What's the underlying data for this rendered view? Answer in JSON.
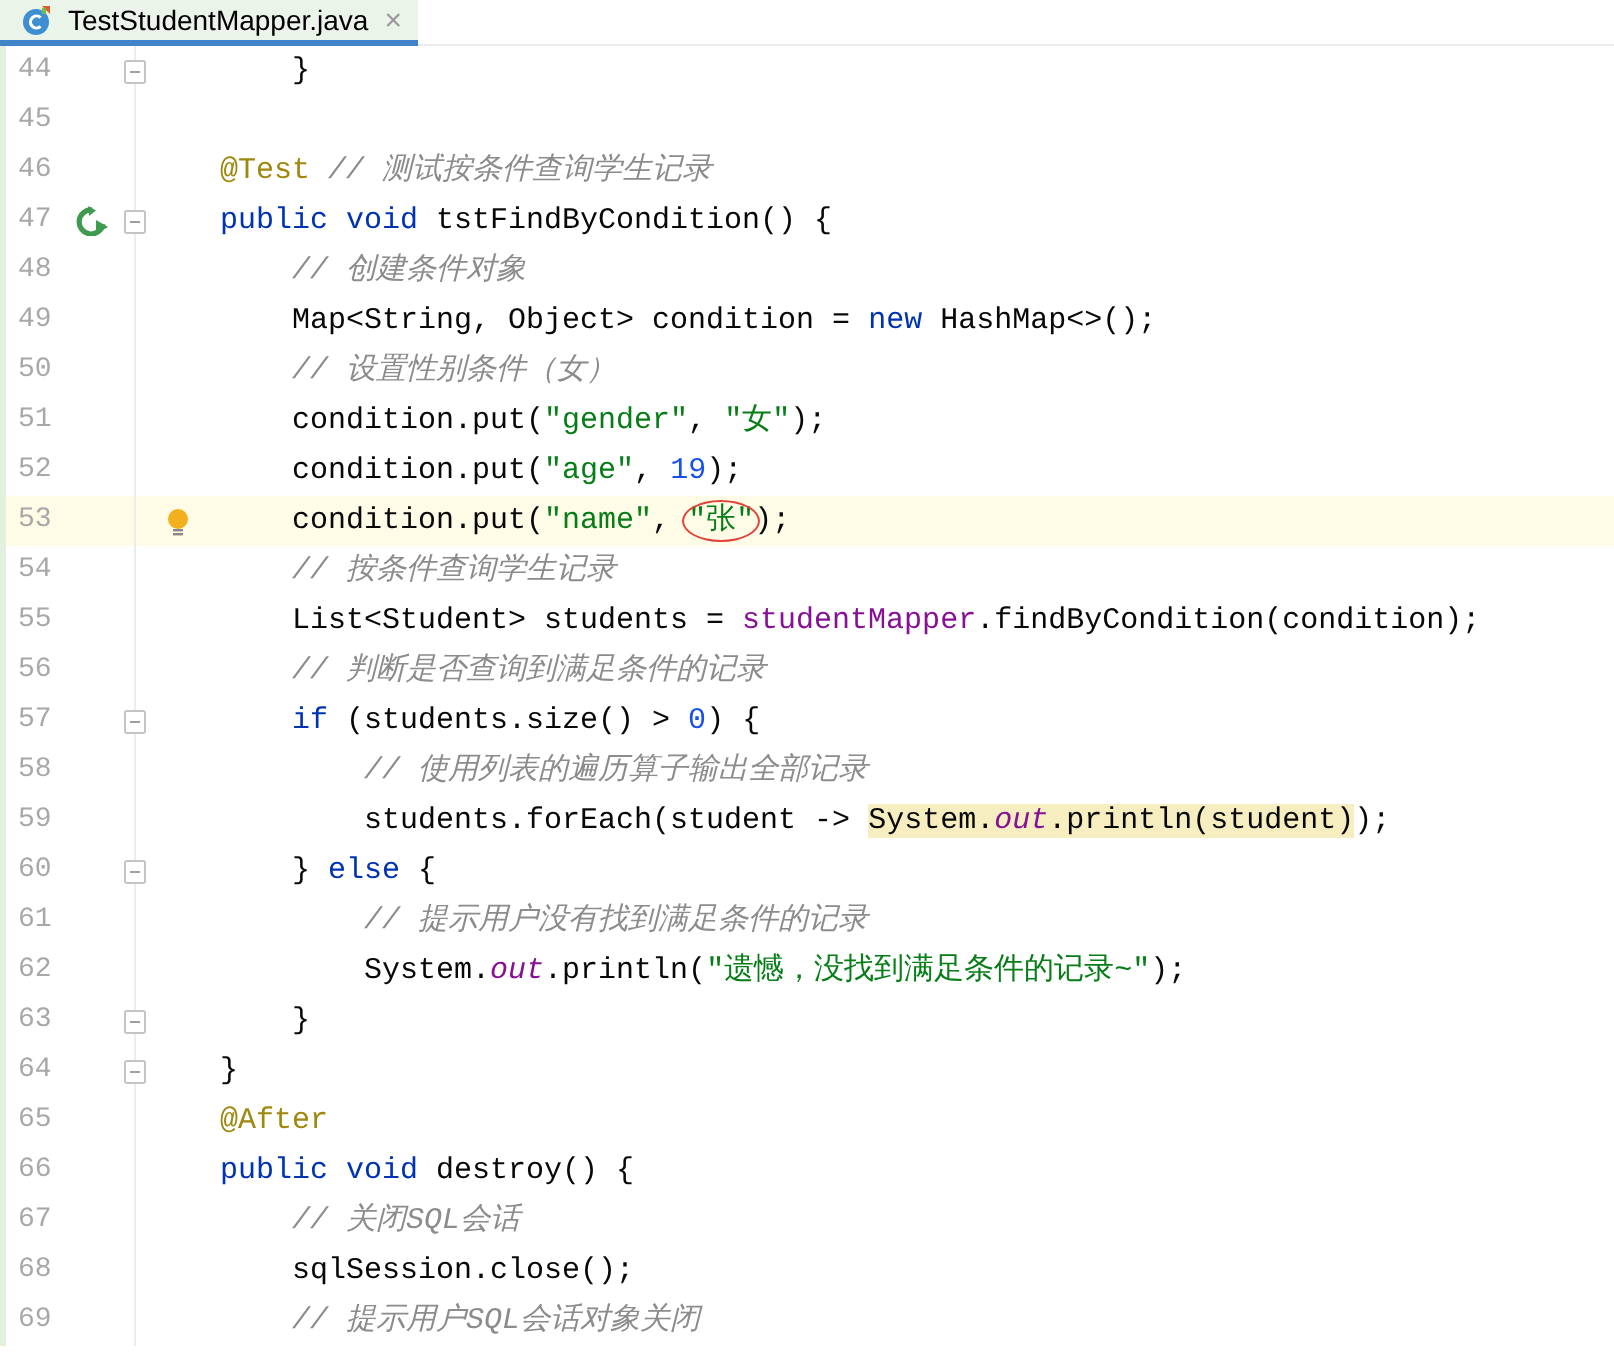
{
  "tabs": [
    {
      "label": "TestStudentMapper.java",
      "close": "×",
      "selected": true
    }
  ],
  "lines": [
    {
      "number": "44",
      "current": false,
      "fold": true,
      "tokens": [
        {
          "kind": "plain",
          "text": "    }"
        }
      ]
    },
    {
      "number": "45",
      "current": false,
      "fold": false
    },
    {
      "number": "46",
      "current": false,
      "fold": false,
      "tokens": [
        {
          "kind": "annotation",
          "text": "@Test"
        },
        {
          "kind": "comment",
          "text": " // 测试按条件查询学生记录"
        }
      ]
    },
    {
      "number": "47",
      "current": false,
      "fold": true,
      "gutter_marker": {
        "kind": "run"
      },
      "tokens": [
        {
          "kind": "keyword",
          "text": "public void "
        },
        {
          "kind": "plain",
          "text": "tstFindByCondition() {"
        }
      ]
    },
    {
      "number": "48",
      "current": false,
      "fold": false,
      "tokens": [
        {
          "kind": "comment",
          "text": "    // 创建条件对象"
        }
      ]
    },
    {
      "number": "49",
      "current": false,
      "fold": false,
      "tokens": [
        {
          "kind": "plain",
          "text": "    Map<String, Object> condition = "
        },
        {
          "kind": "keyword",
          "text": "new "
        },
        {
          "kind": "plain",
          "text": "HashMap<>();"
        }
      ]
    },
    {
      "number": "50",
      "current": false,
      "fold": false,
      "tokens": [
        {
          "kind": "comment",
          "text": "    // 设置性别条件（女）"
        }
      ]
    },
    {
      "number": "51",
      "current": false,
      "fold": false,
      "tokens": [
        {
          "kind": "plain",
          "text": "    condition.put("
        },
        {
          "kind": "string",
          "text": "\"gender\""
        },
        {
          "kind": "plain",
          "text": ", "
        },
        {
          "kind": "string",
          "text": "\"女\""
        },
        {
          "kind": "plain",
          "text": ");"
        }
      ]
    },
    {
      "number": "52",
      "current": false,
      "fold": false,
      "tokens": [
        {
          "kind": "plain",
          "text": "    condition.put("
        },
        {
          "kind": "string",
          "text": "\"age\""
        },
        {
          "kind": "plain",
          "text": ", "
        },
        {
          "kind": "number",
          "text": "19"
        },
        {
          "kind": "plain",
          "text": ");"
        }
      ]
    },
    {
      "number": "53",
      "current": true,
      "fold": false,
      "gutter_marker": {
        "kind": "intention"
      },
      "tokens": [
        {
          "kind": "plain",
          "text": "    condition.put("
        },
        {
          "kind": "string",
          "text": "\"name\""
        },
        {
          "kind": "plain",
          "text": ", "
        },
        {
          "kind": "string",
          "text": "\"张\"",
          "circled": true
        },
        {
          "kind": "plain",
          "text": ");"
        }
      ]
    },
    {
      "number": "54",
      "current": false,
      "fold": false,
      "tokens": [
        {
          "kind": "comment",
          "text": "    // 按条件查询学生记录"
        }
      ]
    },
    {
      "number": "55",
      "current": false,
      "fold": false,
      "tokens": [
        {
          "kind": "plain",
          "text": "    List<Student> students = "
        },
        {
          "kind": "field",
          "text": "studentMapper"
        },
        {
          "kind": "plain",
          "text": ".findByCondition(condition);"
        }
      ]
    },
    {
      "number": "56",
      "current": false,
      "fold": false,
      "tokens": [
        {
          "kind": "comment",
          "text": "    // 判断是否查询到满足条件的记录"
        }
      ]
    },
    {
      "number": "57",
      "current": false,
      "fold": true,
      "tokens": [
        {
          "kind": "keyword",
          "text": "    if "
        },
        {
          "kind": "plain",
          "text": "(students.size() > "
        },
        {
          "kind": "number",
          "text": "0"
        },
        {
          "kind": "plain",
          "text": ") {"
        }
      ]
    },
    {
      "number": "58",
      "current": false,
      "fold": false,
      "tokens": [
        {
          "kind": "comment",
          "text": "        // 使用列表的遍历算子输出全部记录"
        }
      ]
    },
    {
      "number": "59",
      "current": false,
      "fold": false,
      "tokens": [
        {
          "kind": "plain",
          "text": "        students.forEach(student -> "
        },
        {
          "kind": "plain",
          "text": "System.",
          "highlighted": true
        },
        {
          "kind": "static",
          "text": "out",
          "highlighted": true
        },
        {
          "kind": "plain",
          "text": ".println(student)",
          "highlighted": true
        },
        {
          "kind": "plain",
          "text": ");"
        }
      ]
    },
    {
      "number": "60",
      "current": false,
      "fold": true,
      "tokens": [
        {
          "kind": "plain",
          "text": "    } "
        },
        {
          "kind": "keyword",
          "text": "else "
        },
        {
          "kind": "plain",
          "text": "{"
        }
      ]
    },
    {
      "number": "61",
      "current": false,
      "fold": false,
      "tokens": [
        {
          "kind": "comment",
          "text": "        // 提示用户没有找到满足条件的记录"
        }
      ]
    },
    {
      "number": "62",
      "current": false,
      "fold": false,
      "tokens": [
        {
          "kind": "plain",
          "text": "        System."
        },
        {
          "kind": "static",
          "text": "out"
        },
        {
          "kind": "plain",
          "text": ".println("
        },
        {
          "kind": "string",
          "text": "\"遗憾，没找到满足条件的记录~\""
        },
        {
          "kind": "plain",
          "text": ");"
        }
      ]
    },
    {
      "number": "63",
      "current": false,
      "fold": true,
      "tokens": [
        {
          "kind": "plain",
          "text": "    }"
        }
      ]
    },
    {
      "number": "64",
      "current": false,
      "fold": true,
      "tokens": [
        {
          "kind": "plain",
          "text": "}"
        }
      ]
    },
    {
      "number": "65",
      "current": false,
      "fold": false,
      "tokens": [
        {
          "kind": "annotation",
          "text": "@After"
        }
      ]
    },
    {
      "number": "66",
      "current": false,
      "fold": false,
      "tokens": [
        {
          "kind": "keyword",
          "text": "public void "
        },
        {
          "kind": "plain",
          "text": "destroy() {"
        }
      ]
    },
    {
      "number": "67",
      "current": false,
      "fold": false,
      "tokens": [
        {
          "kind": "comment",
          "text": "    // 关闭SQL会话"
        }
      ]
    },
    {
      "number": "68",
      "current": false,
      "fold": false,
      "tokens": [
        {
          "kind": "plain",
          "text": "    sqlSession.close();"
        }
      ]
    },
    {
      "number": "69",
      "current": false,
      "fold": false,
      "tokens": [
        {
          "kind": "comment",
          "text": "    // 提示用户SQL会话对象关闭"
        }
      ]
    }
  ]
}
